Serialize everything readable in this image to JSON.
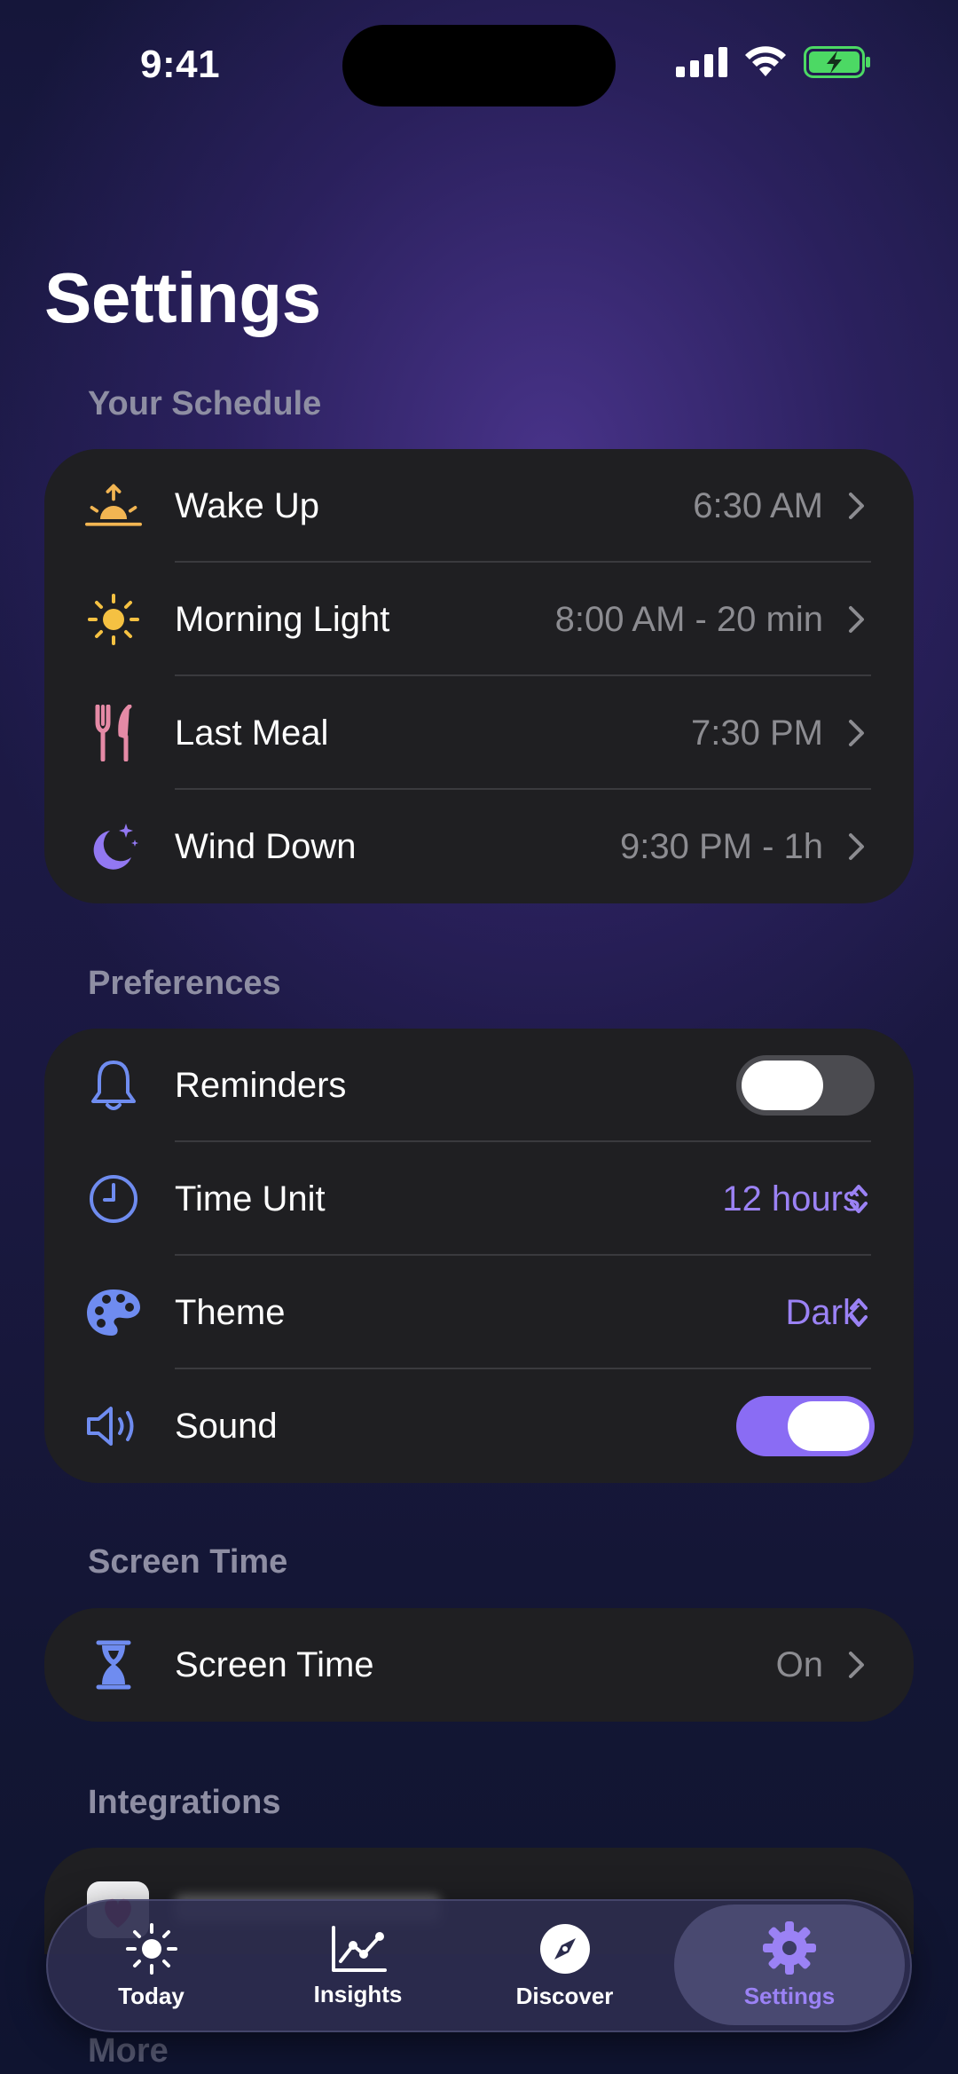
{
  "status_bar": {
    "time": "9:41"
  },
  "page": {
    "title": "Settings"
  },
  "sections": {
    "schedule": {
      "label": "Your Schedule",
      "rows": [
        {
          "label": "Wake Up",
          "value": "6:30 AM",
          "icon": "sunrise-icon"
        },
        {
          "label": "Morning Light",
          "value": "8:00 AM - 20 min",
          "icon": "sun-icon"
        },
        {
          "label": "Last Meal",
          "value": "7:30 PM",
          "icon": "fork-knife-icon"
        },
        {
          "label": "Wind Down",
          "value": "9:30 PM - 1h",
          "icon": "moon-stars-icon"
        }
      ]
    },
    "preferences": {
      "label": "Preferences",
      "rows": [
        {
          "label": "Reminders",
          "toggle": false,
          "icon": "bell-icon"
        },
        {
          "label": "Time Unit",
          "value": "12 hours",
          "icon": "clock-icon"
        },
        {
          "label": "Theme",
          "value": "Dark",
          "icon": "palette-icon"
        },
        {
          "label": "Sound",
          "toggle": true,
          "icon": "speaker-icon"
        }
      ]
    },
    "screen_time": {
      "label": "Screen Time",
      "rows": [
        {
          "label": "Screen Time",
          "value": "On",
          "icon": "hourglass-icon"
        }
      ]
    },
    "integrations": {
      "label": "Integrations"
    },
    "more": {
      "label": "More"
    }
  },
  "tabbar": {
    "tabs": [
      {
        "label": "Today",
        "icon": "sun-icon",
        "active": false
      },
      {
        "label": "Insights",
        "icon": "chart-line-icon",
        "active": false
      },
      {
        "label": "Discover",
        "icon": "compass-icon",
        "active": false
      },
      {
        "label": "Settings",
        "icon": "gear-icon",
        "active": true
      }
    ]
  },
  "colors": {
    "accent": "#9b82f5",
    "card": "#1f1f22",
    "icon_blue": "#6f8cf0",
    "sunrise": "#f2b552",
    "sun": "#f5c142",
    "meal": "#e58aa6",
    "moon": "#9278f2",
    "battery": "#4cd964"
  }
}
